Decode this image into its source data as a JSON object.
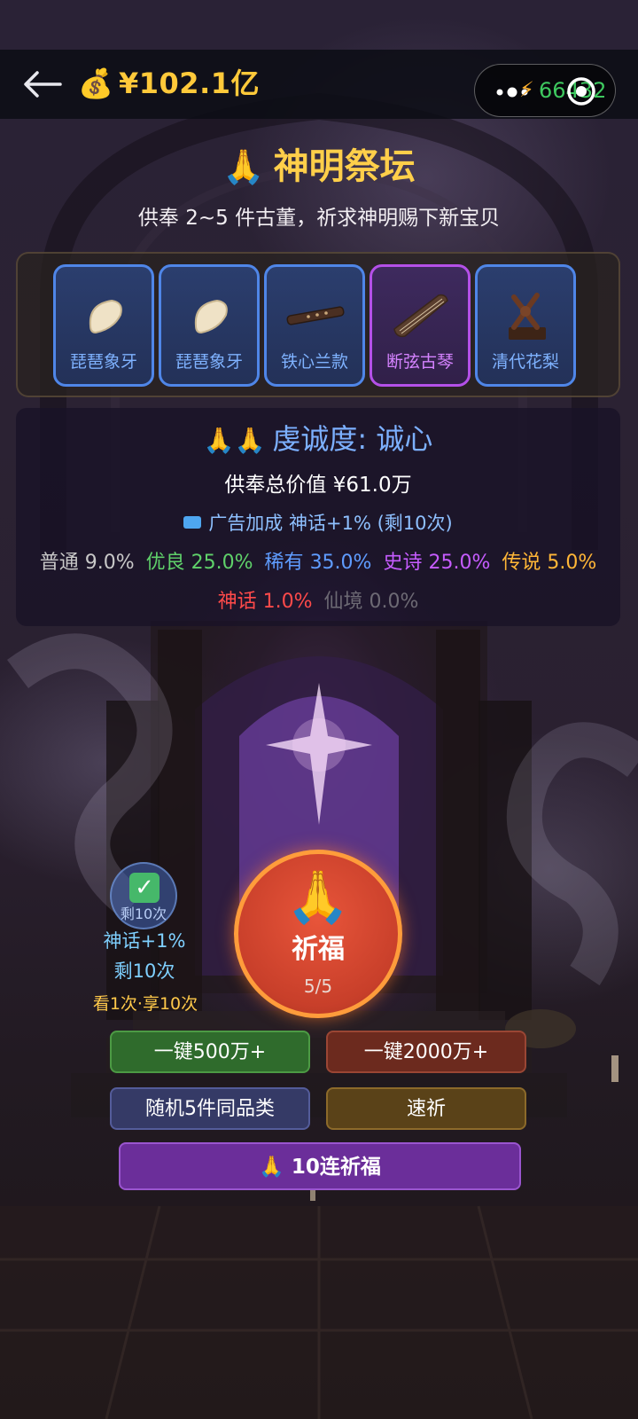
{
  "topbar": {
    "back_icon": "back-arrow-icon",
    "money_icon": "money-bag-icon",
    "money_emoji": "💰",
    "balance": "¥102.1亿",
    "capsule": {
      "menu_icon": "more-dots-icon",
      "energy_icon": "lightning-icon",
      "energy_glyph": "⚡",
      "energy_value": "66432",
      "close_icon": "target-close-icon"
    }
  },
  "altar": {
    "icon_glyph": "🙏",
    "title": "神明祭坛",
    "subtitle": "供奉 2~5 件古董，祈求神明赐下新宝贝"
  },
  "offerings": [
    {
      "name": "琵琶象牙",
      "rarity": "rare",
      "icon": "ivory-plectrum-icon"
    },
    {
      "name": "琵琶象牙",
      "rarity": "rare",
      "icon": "ivory-plectrum-icon"
    },
    {
      "name": "铁心兰款",
      "rarity": "rare",
      "icon": "flute-icon"
    },
    {
      "name": "断弦古琴",
      "rarity": "epic",
      "icon": "guqin-icon"
    },
    {
      "name": "清代花梨",
      "rarity": "rare",
      "icon": "wooden-artifact-icon"
    }
  ],
  "info": {
    "piety_icon": "🙏🙏",
    "piety": "虔诚度: 诚心",
    "total_value": "供奉总价值 ¥61.0万",
    "ad_bonus": "广告加成 神话+1% (剩10次)",
    "rates_line1": [
      {
        "name": "普通",
        "value": "9.0%"
      },
      {
        "name": "优良",
        "value": "25.0%"
      },
      {
        "name": "稀有",
        "value": "35.0%"
      },
      {
        "name": "史诗",
        "value": "25.0%"
      },
      {
        "name": "传说",
        "value": "5.0%"
      }
    ],
    "rates_line2": [
      {
        "name": "神话",
        "value": "1.0%"
      },
      {
        "name": "仙境",
        "value": "0.0%"
      }
    ]
  },
  "ad_badge": {
    "check_glyph": "✓",
    "remaining": "剩10次",
    "bonus": "神话+1%",
    "remaining2": "剩10次",
    "watch": "看1次·享10次"
  },
  "pray_button": {
    "icon_glyph": "🙏",
    "label": "祈福",
    "count": "5/5"
  },
  "buttons": {
    "one_key_500": "一键500万+",
    "one_key_2000": "一键2000万+",
    "random_five": "随机5件同品类",
    "fast_pray": "速祈",
    "ten_pray": "🙏 10连祈福"
  },
  "colors": {
    "gold": "#ffc93a",
    "rare_blue": "#4f86e8",
    "epic_purple": "#b450e8",
    "energy_green": "#3ec95f",
    "pray_red": "#c83f2a"
  }
}
